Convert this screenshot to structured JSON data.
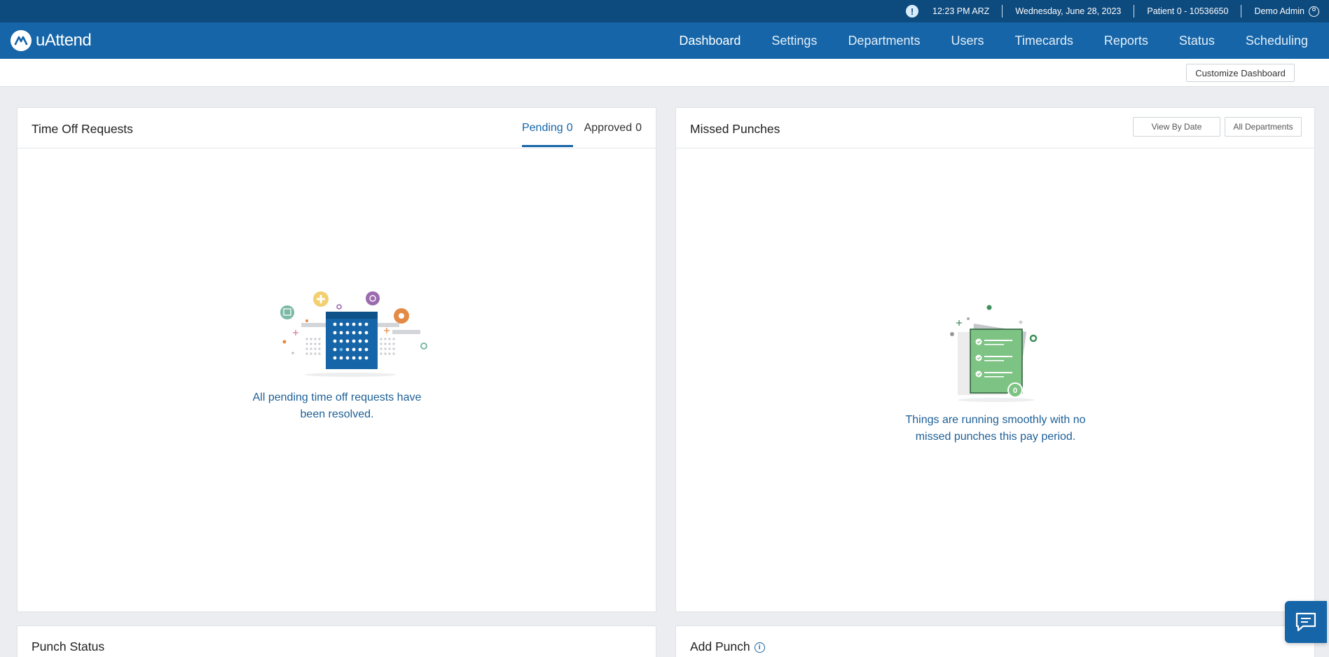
{
  "topbar": {
    "alert_icon": "alert-icon",
    "time": "12:23 PM ARZ",
    "date": "Wednesday, June 28, 2023",
    "account": "Patient 0 - 10536650",
    "user": "Demo Admin"
  },
  "brand": {
    "name": "uAttend"
  },
  "nav": {
    "items": [
      {
        "label": "Dashboard",
        "active": true
      },
      {
        "label": "Settings"
      },
      {
        "label": "Departments"
      },
      {
        "label": "Users"
      },
      {
        "label": "Timecards"
      },
      {
        "label": "Reports"
      },
      {
        "label": "Status"
      },
      {
        "label": "Scheduling"
      }
    ]
  },
  "subheader": {
    "customize_label": "Customize Dashboard"
  },
  "time_off": {
    "title": "Time Off Requests",
    "tabs": [
      {
        "label": "Pending",
        "count": "0"
      },
      {
        "label": "Approved",
        "count": "0"
      }
    ],
    "empty_line1": "All pending time off requests have",
    "empty_line2": "been resolved."
  },
  "missed_punches": {
    "title": "Missed Punches",
    "view_by_date": "View By Date",
    "all_departments": "All Departments",
    "badge": "0",
    "empty_line1": "Things are running smoothly with no",
    "empty_line2": "missed punches this pay period."
  },
  "punch_status": {
    "title": "Punch Status"
  },
  "add_punch": {
    "title": "Add Punch"
  },
  "colors": {
    "primary": "#1565a8",
    "topbar": "#0d4a7e",
    "green": "#7dc383",
    "text_blue": "#1d5f97"
  }
}
